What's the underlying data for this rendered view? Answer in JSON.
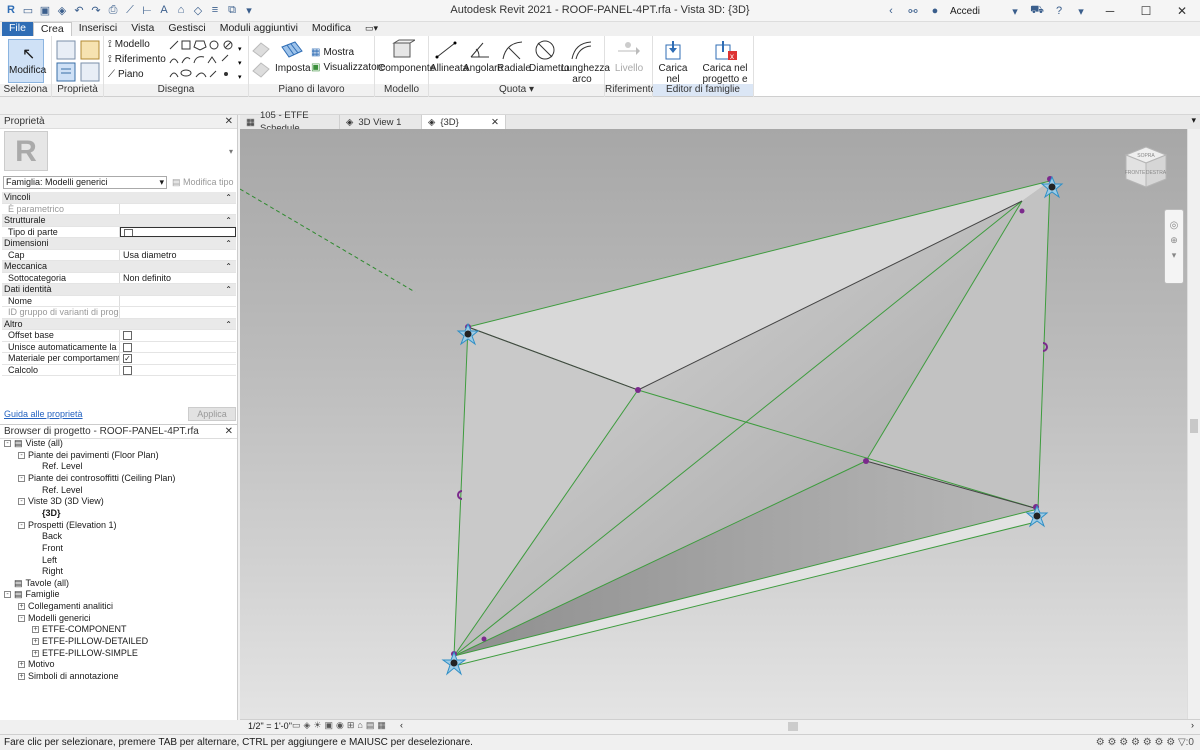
{
  "window": {
    "title": "Autodesk Revit 2021 - ROOF-PANEL-4PT.rfa - Vista 3D: {3D}",
    "signin": "Accedi"
  },
  "ribbon_tabs": [
    "File",
    "Crea",
    "Inserisci",
    "Vista",
    "Gestisci",
    "Moduli aggiuntivi",
    "Modifica"
  ],
  "ribbon": {
    "modifica": "Modifica",
    "seleziona": "Seleziona",
    "proprieta": "Proprietà",
    "disegna": "Disegna",
    "modello": "Modello",
    "riferimento": "Riferimento",
    "piano": "Piano",
    "imposta": "Imposta",
    "mostra": "Mostra",
    "visualizzatore": "Visualizzatore",
    "piano_di_lavoro": "Piano di lavoro",
    "componente": "Componente",
    "modello_panel": "Modello",
    "allineata": "Allineata",
    "angolare": "Angolare",
    "radiale": "Radiale",
    "diametro": "Diametro",
    "lunghezza_1": "Lunghezza",
    "lunghezza_2": "arco",
    "quota": "Quota",
    "livello": "Livello",
    "riferimento_panel": "Riferimento",
    "carica_1": "Carica nel",
    "carica_2": "progetto",
    "caricachiudi_1": "Carica nel",
    "caricachiudi_2": "progetto e chiudi",
    "editor": "Editor di famiglie"
  },
  "doc_tabs": [
    {
      "label": "105 - ETFE Schedule"
    },
    {
      "label": "3D View 1"
    },
    {
      "label": "{3D}"
    }
  ],
  "properties": {
    "title": "Proprietà",
    "family_select": "Famiglia: Modelli generici",
    "edit_type": "Modifica tipo",
    "rows": [
      {
        "k": "Vincoli",
        "cat": true
      },
      {
        "k": "È parametrico",
        "v": "",
        "dim": true
      },
      {
        "k": "Strutturale",
        "cat": true
      },
      {
        "k": "Tipo di parte",
        "v": "",
        "cb": true,
        "checked": false,
        "boxed": true
      },
      {
        "k": "Dimensioni",
        "cat": true
      },
      {
        "k": "Cap",
        "v": "Usa diametro"
      },
      {
        "k": "Meccanica",
        "cat": true
      },
      {
        "k": "Sottocategoria",
        "v": "Non definito"
      },
      {
        "k": "Dati identità",
        "cat": true
      },
      {
        "k": "Nome",
        "v": ""
      },
      {
        "k": "ID gruppo di varianti di progetto",
        "v": "",
        "dim": true
      },
      {
        "k": "Altro",
        "cat": true
      },
      {
        "k": "Offset base",
        "cb": true,
        "checked": false
      },
      {
        "k": "Unisce automaticamente la ge...",
        "cb": true,
        "checked": false
      },
      {
        "k": "Materiale per comportamento ...",
        "cb": true,
        "checked": true
      },
      {
        "k": "Calcolo",
        "cb": true,
        "checked": false
      }
    ],
    "help_link": "Guida alle proprietà",
    "apply": "Applica"
  },
  "browser": {
    "title": "Browser di progetto - ROOF-PANEL-4PT.rfa",
    "items": [
      {
        "label": "Viste (all)",
        "level": 0,
        "box": "-"
      },
      {
        "label": "Piante dei pavimenti (Floor Plan)",
        "level": 1,
        "box": "-"
      },
      {
        "label": "Ref. Level",
        "level": 2
      },
      {
        "label": "Piante dei controsoffitti (Ceiling Plan)",
        "level": 1,
        "box": "-"
      },
      {
        "label": "Ref. Level",
        "level": 2
      },
      {
        "label": "Viste 3D (3D View)",
        "level": 1,
        "box": "-"
      },
      {
        "label": "{3D}",
        "level": 2,
        "bold": true
      },
      {
        "label": "Prospetti (Elevation 1)",
        "level": 1,
        "box": "-"
      },
      {
        "label": "Back",
        "level": 2
      },
      {
        "label": "Front",
        "level": 2
      },
      {
        "label": "Left",
        "level": 2
      },
      {
        "label": "Right",
        "level": 2
      },
      {
        "label": "Tavole (all)",
        "level": 0
      },
      {
        "label": "Famiglie",
        "level": 0,
        "box": "-"
      },
      {
        "label": "Collegamenti analitici",
        "level": 1,
        "box": "+"
      },
      {
        "label": "Modelli generici",
        "level": 1,
        "box": "-"
      },
      {
        "label": "ETFE-COMPONENT",
        "level": 2,
        "box": "+"
      },
      {
        "label": "ETFE-PILLOW-DETAILED",
        "level": 2,
        "box": "+"
      },
      {
        "label": "ETFE-PILLOW-SIMPLE",
        "level": 2,
        "box": "+"
      },
      {
        "label": "Motivo",
        "level": 1,
        "box": "+"
      },
      {
        "label": "Simboli di annotazione",
        "level": 1,
        "box": "+"
      }
    ]
  },
  "viewcube": {
    "top": "SOPRA",
    "front": "FRONTE",
    "right": "DESTRA"
  },
  "view_scale": "1/2\" = 1'-0\"",
  "status": "Fare clic per selezionare, premere TAB per alternare, CTRL per aggiungere e MAIUSC per deselezionare.",
  "status_right": ":0",
  "colors": {
    "accent": "#2f6db5",
    "edge_green": "#3e9c3e",
    "point_purple": "#7b2a8c",
    "node_blue": "#2f8fc6"
  }
}
